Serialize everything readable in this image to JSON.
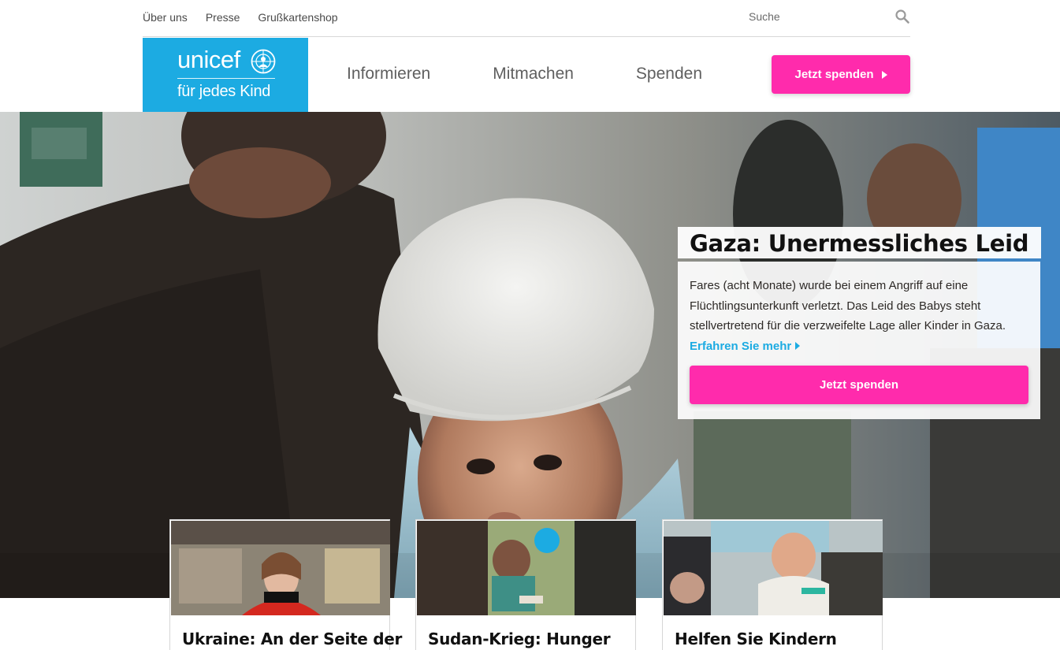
{
  "utility_nav": {
    "links": [
      "Über uns",
      "Presse",
      "Grußkartenshop"
    ],
    "search_placeholder": "Suche",
    "search_icon": "magnifier-icon"
  },
  "logo": {
    "wordmark": "unicef",
    "tagline": "für jedes Kind",
    "emblem_icon": "unicef-emblem-icon",
    "color": "#1cabe2"
  },
  "main_nav": {
    "items": [
      "Informieren",
      "Mitmachen",
      "Spenden"
    ],
    "donate_button": "Jetzt spenden"
  },
  "hero": {
    "title": "Gaza: Unermessliches Leid",
    "text": "Fares (acht Monate) wurde bei einem Angriff auf eine Flüchtlingsunterkunft verletzt. Das Leid des Babys steht stellvertretend für die verzweifelte Lage aller Kinder in Gaza.",
    "more_link": "Erfahren Sie mehr",
    "donate_button": "Jetzt spenden"
  },
  "cards": [
    {
      "title": "Ukraine: An der Seite der"
    },
    {
      "title": "Sudan-Krieg: Hunger"
    },
    {
      "title": "Helfen Sie Kindern"
    }
  ],
  "colors": {
    "brand_blue": "#1cabe2",
    "donate_pink": "#ff2bac",
    "text_dark": "#2d2926"
  }
}
